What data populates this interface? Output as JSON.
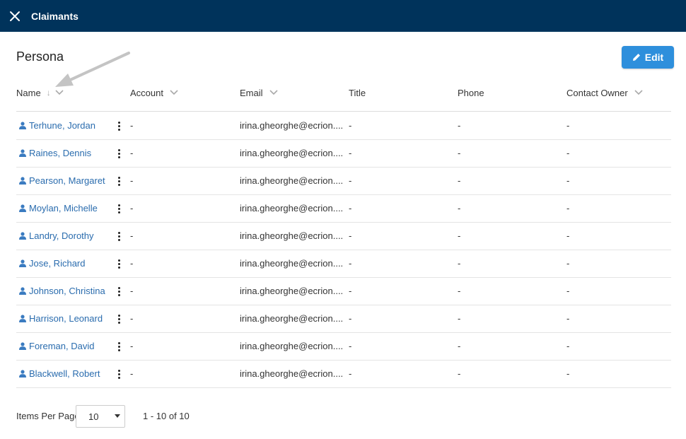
{
  "header": {
    "title": "Claimants"
  },
  "section": {
    "title": "Persona",
    "edit_label": "Edit"
  },
  "columns": [
    {
      "label": "Name"
    },
    {
      "label": "Account"
    },
    {
      "label": "Email"
    },
    {
      "label": "Title"
    },
    {
      "label": "Phone"
    },
    {
      "label": "Contact Owner"
    }
  ],
  "rows": [
    {
      "name": "Terhune, Jordan",
      "account": "-",
      "email": "irina.gheorghe@ecrion....",
      "title": "-",
      "phone": "-",
      "owner": "-"
    },
    {
      "name": "Raines, Dennis",
      "account": "-",
      "email": "irina.gheorghe@ecrion....",
      "title": "-",
      "phone": "-",
      "owner": "-"
    },
    {
      "name": "Pearson, Margaret",
      "account": "-",
      "email": "irina.gheorghe@ecrion....",
      "title": "-",
      "phone": "-",
      "owner": "-"
    },
    {
      "name": "Moylan, Michelle",
      "account": "-",
      "email": "irina.gheorghe@ecrion....",
      "title": "-",
      "phone": "-",
      "owner": "-"
    },
    {
      "name": "Landry, Dorothy",
      "account": "-",
      "email": "irina.gheorghe@ecrion....",
      "title": "-",
      "phone": "-",
      "owner": "-"
    },
    {
      "name": "Jose, Richard",
      "account": "-",
      "email": "irina.gheorghe@ecrion....",
      "title": "-",
      "phone": "-",
      "owner": "-"
    },
    {
      "name": "Johnson, Christina",
      "account": "-",
      "email": "irina.gheorghe@ecrion....",
      "title": "-",
      "phone": "-",
      "owner": "-"
    },
    {
      "name": "Harrison, Leonard",
      "account": "-",
      "email": "irina.gheorghe@ecrion....",
      "title": "-",
      "phone": "-",
      "owner": "-"
    },
    {
      "name": "Foreman, David",
      "account": "-",
      "email": "irina.gheorghe@ecrion....",
      "title": "-",
      "phone": "-",
      "owner": "-"
    },
    {
      "name": "Blackwell, Robert",
      "account": "-",
      "email": "irina.gheorghe@ecrion....",
      "title": "-",
      "phone": "-",
      "owner": "-"
    }
  ],
  "footer": {
    "items_per_page_label": "Items Per Page",
    "per_page_value": "10",
    "range": "1 - 10 of 10"
  },
  "colors": {
    "topbar": "#00335b",
    "accent": "#2e8fdc",
    "link": "#2a6cae"
  }
}
